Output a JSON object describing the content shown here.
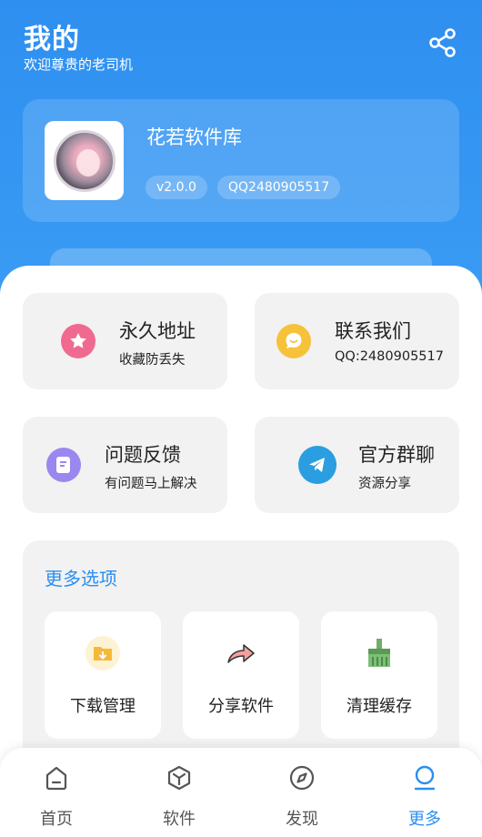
{
  "header": {
    "title": "我的",
    "subtitle": "欢迎尊贵的老司机",
    "share_icon": "share-icon"
  },
  "profile": {
    "app_name": "花若软件库",
    "version": "v2.0.0",
    "qq": "QQ2480905517"
  },
  "cards": [
    {
      "title": "永久地址",
      "desc": "收藏防丢失",
      "icon": "star-icon",
      "color": "#f06a8f"
    },
    {
      "title": "联系我们",
      "desc": "QQ:2480905517",
      "icon": "chat-icon",
      "color": "#f5c23a"
    },
    {
      "title": "问题反馈",
      "desc": "有问题马上解决",
      "icon": "feedback-icon",
      "color": "#9b87f0"
    },
    {
      "title": "官方群聊",
      "desc": "资源分享",
      "icon": "telegram-icon",
      "color": "#2a9ee0"
    }
  ],
  "more": {
    "title": "更多选项",
    "items": [
      {
        "label": "下载管理",
        "icon": "download-folder-icon"
      },
      {
        "label": "分享软件",
        "icon": "forward-arrow-icon"
      },
      {
        "label": "清理缓存",
        "icon": "broom-icon"
      }
    ]
  },
  "tabs": [
    {
      "label": "首页",
      "icon": "home-icon"
    },
    {
      "label": "软件",
      "icon": "cube-icon"
    },
    {
      "label": "发现",
      "icon": "compass-icon"
    },
    {
      "label": "更多",
      "icon": "person-icon",
      "active": true
    }
  ],
  "colors": {
    "accent": "#2b8ff0",
    "header": "#3a9cf4",
    "card_bg": "#f2f2f2"
  }
}
